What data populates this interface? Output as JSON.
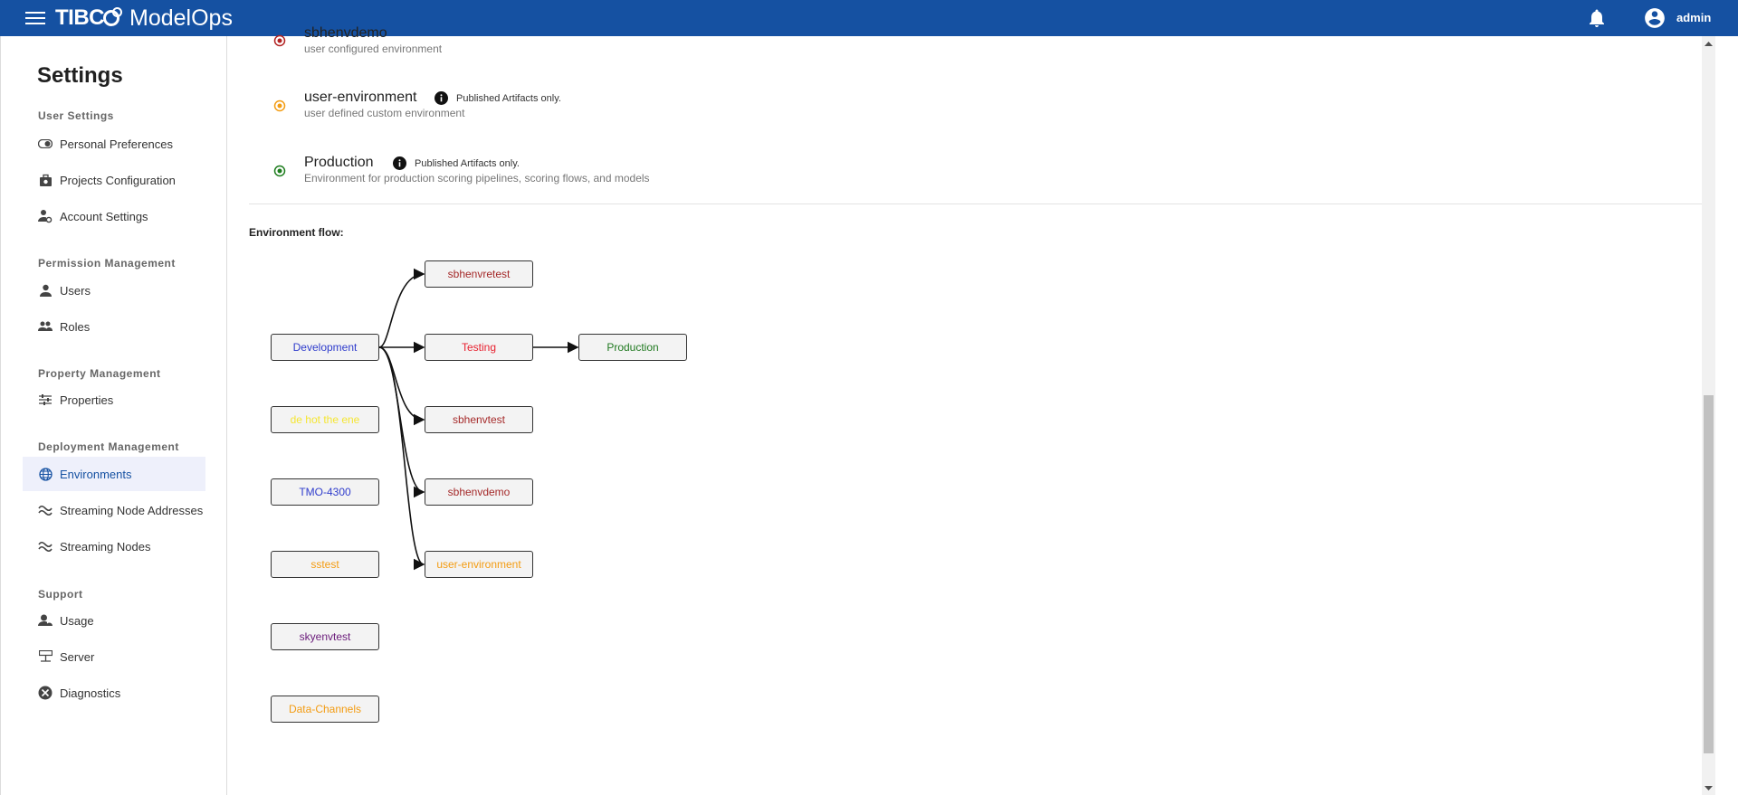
{
  "app": {
    "brand": "TIBC",
    "product": "ModelOps",
    "user": "admin"
  },
  "sidebar": {
    "title": "Settings",
    "sections": [
      {
        "heading": "User Settings"
      },
      {
        "heading": "Permission Management"
      },
      {
        "heading": "Property Management"
      },
      {
        "heading": "Deployment Management"
      },
      {
        "heading": "Support"
      }
    ],
    "items": [
      {
        "label": "Personal Preferences",
        "icon": "toggle-icon"
      },
      {
        "label": "Projects Configuration",
        "icon": "briefcase-gear-icon"
      },
      {
        "label": "Account Settings",
        "icon": "person-gear-icon"
      },
      {
        "label": "Users",
        "icon": "person-icon"
      },
      {
        "label": "Roles",
        "icon": "people-icon"
      },
      {
        "label": "Properties",
        "icon": "sliders-icon"
      },
      {
        "label": "Environments",
        "icon": "globe-icon"
      },
      {
        "label": "Streaming Node Addresses",
        "icon": "waves-icon"
      },
      {
        "label": "Streaming Nodes",
        "icon": "waves-icon"
      },
      {
        "label": "Usage",
        "icon": "gauge-icon"
      },
      {
        "label": "Server",
        "icon": "server-icon"
      },
      {
        "label": "Diagnostics",
        "icon": "diagnostics-icon"
      }
    ],
    "active": "Environments"
  },
  "environments": [
    {
      "name": "sbhenvdemo",
      "description": "user configured environment",
      "color": "#b22222",
      "note": ""
    },
    {
      "name": "user-environment",
      "description": "user defined custom environment",
      "color": "#f39c12",
      "note": "Published Artifacts only."
    },
    {
      "name": "Production",
      "description": "Environment for production scoring pipelines, scoring flows, and models",
      "color": "#1e7d1e",
      "note": "Published Artifacts only."
    }
  ],
  "flow": {
    "label": "Environment flow:",
    "nodes": [
      {
        "id": "sbhenvretest",
        "label": "sbhenvretest",
        "color": "#a52a2a"
      },
      {
        "id": "development",
        "label": "Development",
        "color": "#2f3ccc"
      },
      {
        "id": "testing",
        "label": "Testing",
        "color": "#e8212f"
      },
      {
        "id": "production",
        "label": "Production",
        "color": "#217a21"
      },
      {
        "id": "dehelloo",
        "label": "de hot the ene",
        "color": "#f5e632"
      },
      {
        "id": "sbhenvtest",
        "label": "sbhenvtest",
        "color": "#a52a2a"
      },
      {
        "id": "tmo",
        "label": "TMO-4300",
        "color": "#2f3ccc"
      },
      {
        "id": "sbhenvdemo",
        "label": "sbhenvdemo",
        "color": "#a52a2a"
      },
      {
        "id": "sstest",
        "label": "sstest",
        "color": "#f39c12"
      },
      {
        "id": "userenv",
        "label": "user-environment",
        "color": "#f39c12"
      },
      {
        "id": "skyenvtest",
        "label": "skyenvtest",
        "color": "#6a1b7a"
      },
      {
        "id": "datachannels",
        "label": "Data-Channels",
        "color": "#f39c12"
      }
    ]
  }
}
